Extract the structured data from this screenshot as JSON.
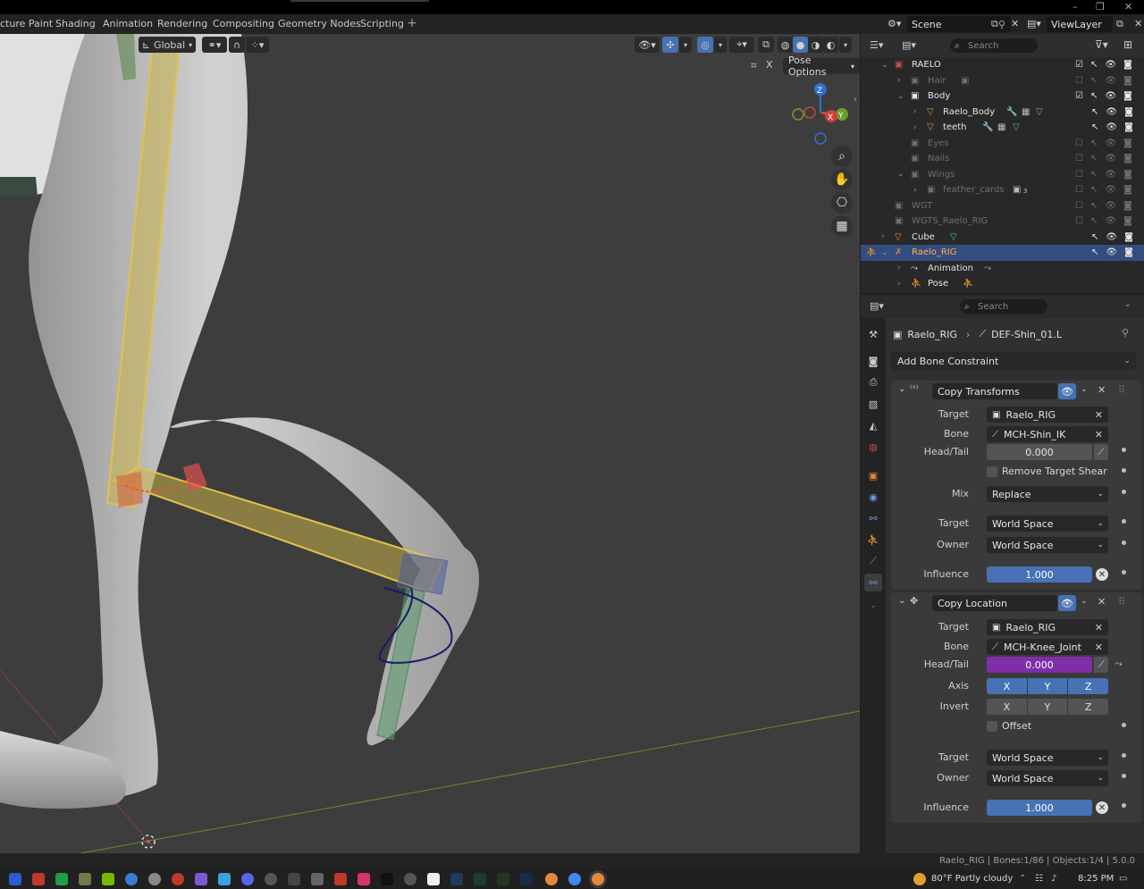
{
  "workspace_tabs": [
    "cture Paint",
    "Shading",
    "Animation",
    "Rendering",
    "Compositing",
    "Geometry Nodes",
    "Scripting"
  ],
  "scene_bar": {
    "scene": "Scene",
    "view_layer": "ViewLayer"
  },
  "viewport": {
    "orientation": "Global",
    "pose_options": "Pose Options",
    "gizmo_axes": {
      "z": "Z",
      "y": "Y",
      "x": "X"
    }
  },
  "outliner": {
    "search_placeholder": "Search",
    "items": [
      {
        "name": "RAELO"
      },
      {
        "name": "Hair"
      },
      {
        "name": "Body"
      },
      {
        "name": "Raelo_Body"
      },
      {
        "name": "teeth"
      },
      {
        "name": "Eyes"
      },
      {
        "name": "Nails"
      },
      {
        "name": "Wings"
      },
      {
        "name": "feather_cards",
        "badge": "3"
      },
      {
        "name": "WGT"
      },
      {
        "name": "WGTS_Raelo_RIG"
      },
      {
        "name": "Cube"
      },
      {
        "name": "Raelo_RIG"
      },
      {
        "name": "Animation"
      },
      {
        "name": "Pose"
      }
    ]
  },
  "properties": {
    "search_placeholder": "Search",
    "breadcrumb": {
      "object": "Raelo_RIG",
      "bone": "DEF-Shin_01.L"
    },
    "add_constraint": "Add Bone Constraint",
    "copy_transforms": {
      "name": "Copy Transforms",
      "target_label": "Target",
      "target": "Raelo_RIG",
      "bone_label": "Bone",
      "bone": "MCH-Shin_IK",
      "headtail_label": "Head/Tail",
      "headtail": "0.000",
      "remove_shear": "Remove Target Shear",
      "mix_label": "Mix",
      "mix": "Replace",
      "target_space_label": "Target",
      "target_space": "World Space",
      "owner_space_label": "Owner",
      "owner_space": "World Space",
      "influence_label": "Influence",
      "influence": "1.000"
    },
    "copy_location": {
      "name": "Copy Location",
      "target_label": "Target",
      "target": "Raelo_RIG",
      "bone_label": "Bone",
      "bone": "MCH-Knee_Joint",
      "headtail_label": "Head/Tail",
      "headtail": "0.000",
      "axis_label": "Axis",
      "axis": [
        "X",
        "Y",
        "Z"
      ],
      "invert_label": "Invert",
      "invert": [
        "X",
        "Y",
        "Z"
      ],
      "offset": "Offset",
      "target_space_label": "Target",
      "target_space": "World Space",
      "owner_space_label": "Owner",
      "owner_space": "World Space",
      "influence_label": "Influence",
      "influence": "1.000"
    }
  },
  "status_bar": "Raelo_RIG | Bones:1/86 | Objects:1/4 | 5.0.0",
  "taskbar": {
    "weather": "80°F  Partly cloudy",
    "time": "8:25 PM"
  },
  "colors": {
    "accent": "#4772b3",
    "selection": "#334d80",
    "driven": "#7e2fa8"
  }
}
